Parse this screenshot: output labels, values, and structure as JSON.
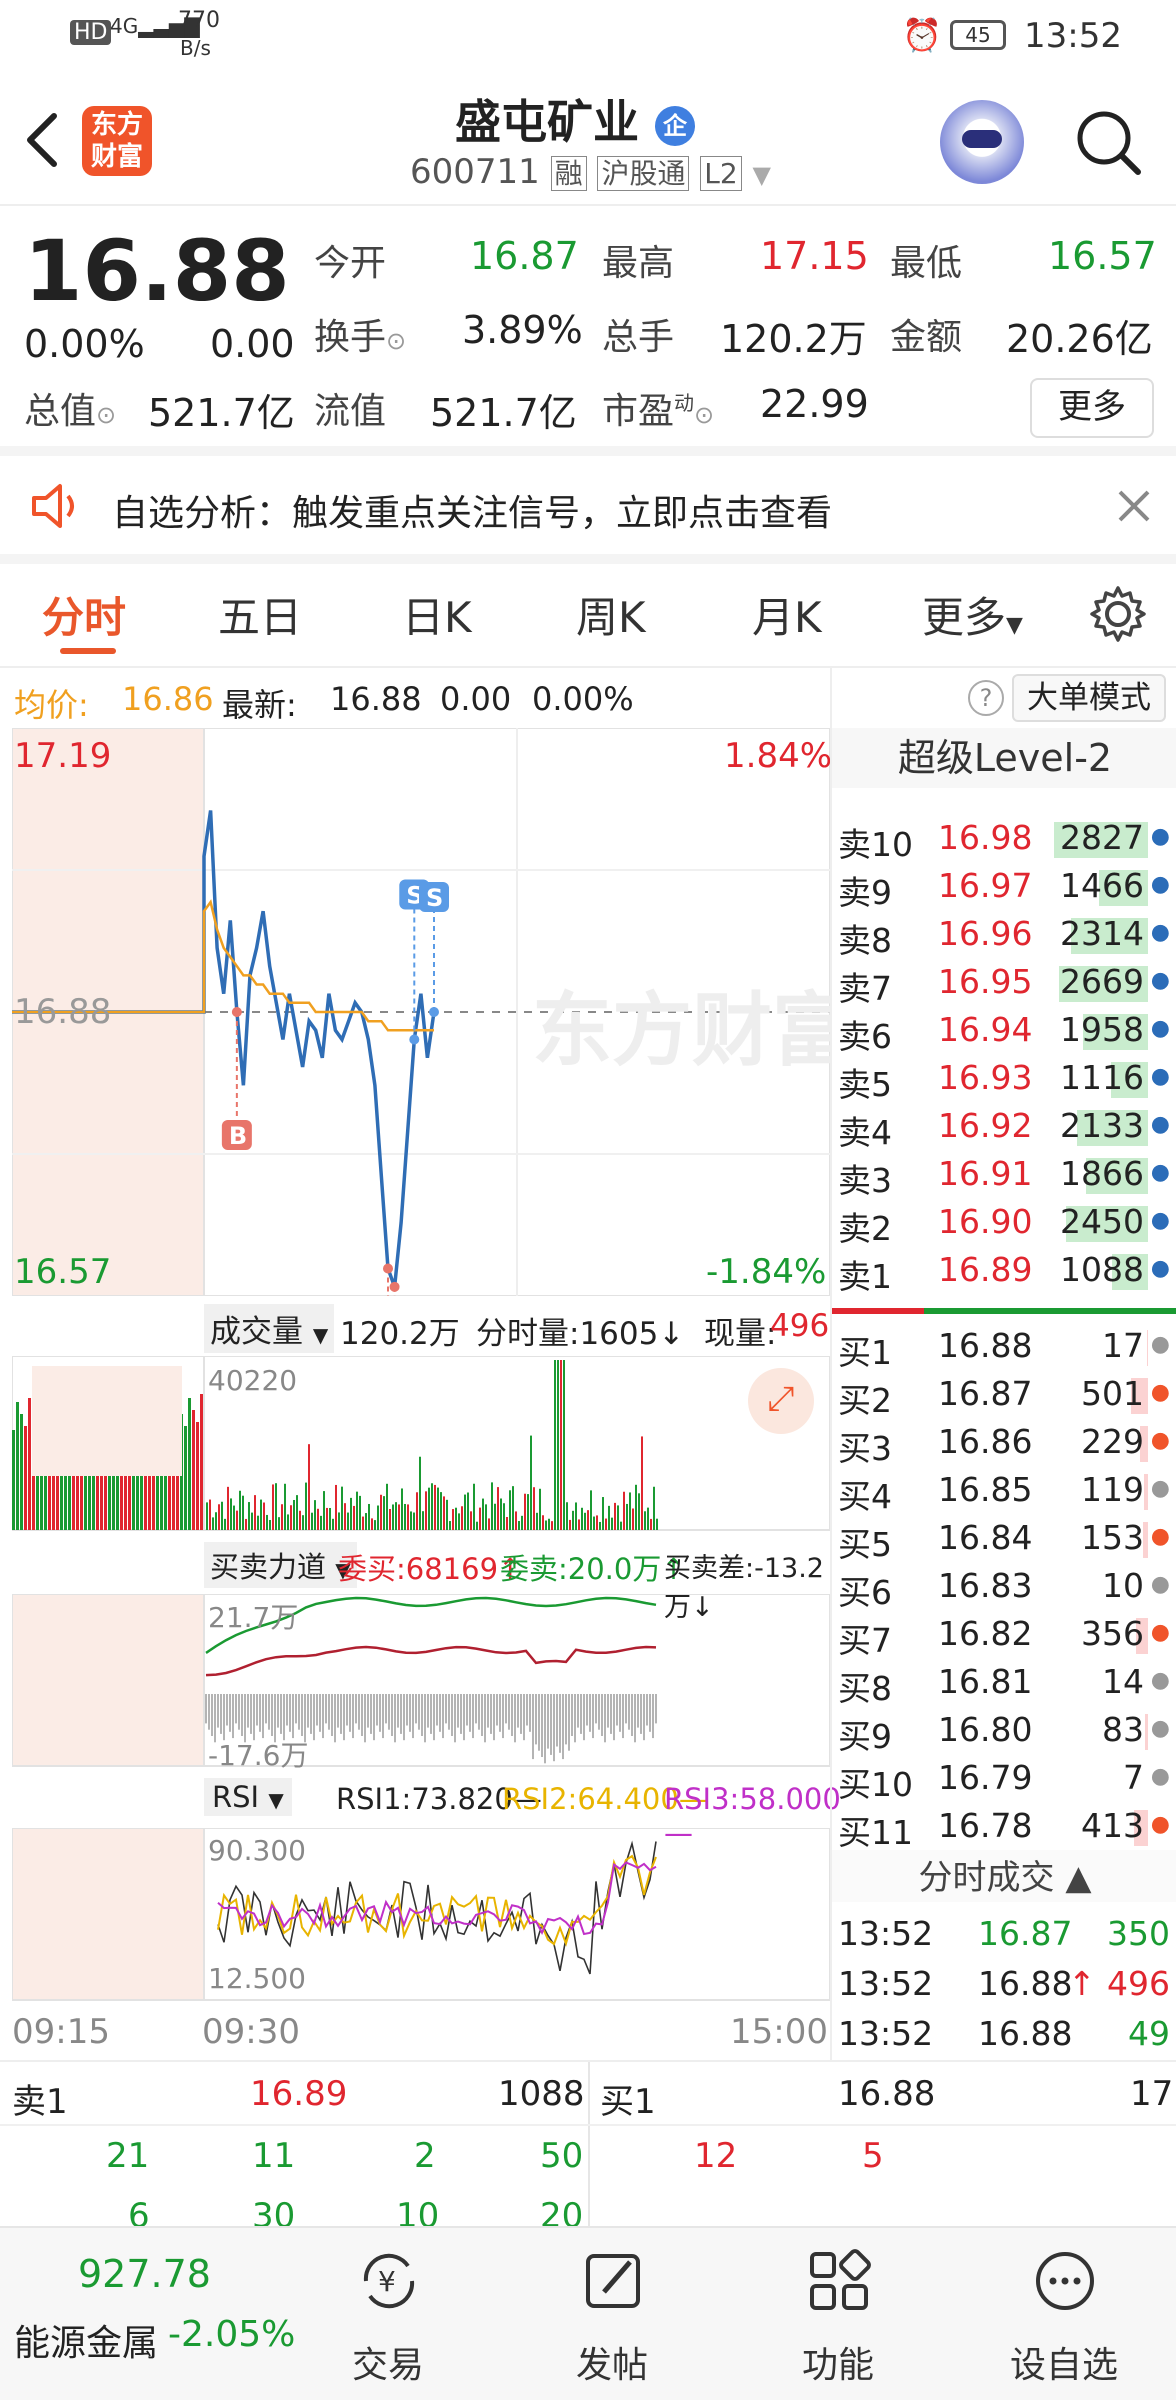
{
  "status": {
    "net_label": "HD",
    "net_speed": "770",
    "net_unit": "B/s",
    "battery": "45",
    "time": "13:52"
  },
  "header": {
    "title": "盛屯矿业",
    "badge": "企",
    "code": "600711",
    "tags": [
      "融",
      "沪股通",
      "L2"
    ]
  },
  "quote": {
    "price": "16.88",
    "change_pct": "0.00%",
    "change": "0.00",
    "open_label": "今开",
    "open": "16.87",
    "high_label": "最高",
    "high": "17.15",
    "low_label": "最低",
    "low": "16.57",
    "turnover_label": "换手",
    "turnover": "3.89%",
    "volume_label": "总手",
    "volume": "120.2万",
    "amount_label": "金额",
    "amount": "20.26亿",
    "total_value_label": "总值",
    "total_value": "521.7亿",
    "float_value_label": "流值",
    "float_value": "521.7亿",
    "pe_label": "市盈",
    "pe_sup": "动",
    "pe": "22.99",
    "more_button": "更多"
  },
  "notice": {
    "text": "自选分析：触发重点关注信号，立即点击查看"
  },
  "tabs": [
    "分时",
    "五日",
    "日K",
    "周K",
    "月K",
    "更多"
  ],
  "avg_bar": {
    "avg_label": "均价:",
    "avg_value": "16.86",
    "latest_label": "最新:",
    "latest_value": "16.88",
    "change": "0.00",
    "change_pct": "0.00%",
    "mode_button": "大单模式"
  },
  "chart": {
    "price_top": "17.19",
    "price_bottom": "16.57",
    "price_mid": "16.88",
    "pct_top": "1.84%",
    "pct_bottom": "-1.84%",
    "markers": [
      "B",
      "B",
      "B",
      "S",
      "S"
    ],
    "watermark": "东方财富",
    "volume_header": {
      "selector": "成交量",
      "total": "120.2万",
      "minute_label": "分时量:1605",
      "now_label": "现量:",
      "now_value": "496",
      "max_label": "40220"
    },
    "force_header": {
      "selector": "买卖力道",
      "buy": "委买:68169",
      "sell": "委卖:20.0万",
      "diff": "买卖差:-13.2万"
    },
    "force_labels": {
      "top": "21.7万",
      "bottom": "-17.6万"
    },
    "rsi_header": {
      "selector": "RSI",
      "rsi1": "RSI1:73.820",
      "rsi2": "RSI2:64.400",
      "rsi3": "RSI3:58.000"
    },
    "rsi_labels": {
      "top": "90.300",
      "bottom": "12.500"
    },
    "time_axis": [
      "09:15",
      "09:30",
      "15:00"
    ],
    "colors": {
      "price": "#2f6db5",
      "avg": "#f0a020",
      "up": "#e0262f",
      "down": "#1a9a32"
    }
  },
  "chart_data": {
    "type": "line",
    "ylim": [
      16.57,
      17.19
    ],
    "series": [
      {
        "values": [
          16.88,
          16.88,
          16.88,
          16.88,
          16.88,
          16.88,
          17.05,
          17.1,
          16.95,
          16.9,
          16.98,
          16.88,
          16.8,
          16.92,
          16.95,
          16.99,
          16.93,
          16.89,
          16.85,
          16.9,
          16.86,
          16.82,
          16.87,
          16.86,
          16.83,
          16.9,
          16.86,
          16.85,
          16.87,
          16.89,
          16.88,
          16.85,
          16.8,
          16.7,
          16.6,
          16.58,
          16.65,
          16.75,
          16.85,
          16.9,
          16.83,
          16.88
        ]
      },
      {
        "values": [
          16.88,
          16.88,
          16.88,
          16.88,
          16.88,
          16.88,
          16.99,
          17.0,
          16.97,
          16.95,
          16.94,
          16.93,
          16.92,
          16.92,
          16.91,
          16.91,
          16.9,
          16.9,
          16.9,
          16.89,
          16.89,
          16.89,
          16.89,
          16.88,
          16.88,
          16.88,
          16.88,
          16.88,
          16.88,
          16.88,
          16.88,
          16.87,
          16.87,
          16.87,
          16.86,
          16.86,
          16.86,
          16.86,
          16.86,
          16.86,
          16.86,
          16.86
        ]
      }
    ]
  },
  "orderbook": {
    "title": "超级Level-2",
    "asks": [
      {
        "label": "卖10",
        "price": "16.98",
        "vol": "2827"
      },
      {
        "label": "卖9",
        "price": "16.97",
        "vol": "1466"
      },
      {
        "label": "卖8",
        "price": "16.96",
        "vol": "2314"
      },
      {
        "label": "卖7",
        "price": "16.95",
        "vol": "2669"
      },
      {
        "label": "卖6",
        "price": "16.94",
        "vol": "1958"
      },
      {
        "label": "卖5",
        "price": "16.93",
        "vol": "1116"
      },
      {
        "label": "卖4",
        "price": "16.92",
        "vol": "2133"
      },
      {
        "label": "卖3",
        "price": "16.91",
        "vol": "1866"
      },
      {
        "label": "卖2",
        "price": "16.90",
        "vol": "2450"
      },
      {
        "label": "卖1",
        "price": "16.89",
        "vol": "1088"
      }
    ],
    "bids": [
      {
        "label": "买1",
        "price": "16.88",
        "vol": "17"
      },
      {
        "label": "买2",
        "price": "16.87",
        "vol": "501"
      },
      {
        "label": "买3",
        "price": "16.86",
        "vol": "229"
      },
      {
        "label": "买4",
        "price": "16.85",
        "vol": "119"
      },
      {
        "label": "买5",
        "price": "16.84",
        "vol": "153"
      },
      {
        "label": "买6",
        "price": "16.83",
        "vol": "10"
      },
      {
        "label": "买7",
        "price": "16.82",
        "vol": "356"
      },
      {
        "label": "买8",
        "price": "16.81",
        "vol": "14"
      },
      {
        "label": "买9",
        "price": "16.80",
        "vol": "83"
      },
      {
        "label": "买10",
        "price": "16.79",
        "vol": "7"
      },
      {
        "label": "买11",
        "price": "16.78",
        "vol": "413"
      }
    ],
    "trades_title": "分时成交",
    "trades": [
      {
        "time": "13:52",
        "price": "16.87",
        "vol": "350"
      },
      {
        "time": "13:52",
        "price": "16.88",
        "vol": "496"
      },
      {
        "time": "13:52",
        "price": "16.88",
        "vol": "49"
      }
    ]
  },
  "queue": {
    "sell_label": "卖1",
    "sell_price": "16.89",
    "sell_vol": "1088",
    "buy_label": "买1",
    "buy_price": "16.88",
    "buy_vol": "17",
    "sell_row1": [
      "21",
      "11",
      "2",
      "50"
    ],
    "sell_row2": [
      "6",
      "30",
      "10",
      "20"
    ],
    "buy_row1": [
      "12",
      "5"
    ]
  },
  "bottomnav": {
    "index_value": "927.78",
    "index_name": "能源金属",
    "index_change": "-2.05%",
    "items": [
      "交易",
      "发帖",
      "功能",
      "设自选"
    ]
  }
}
